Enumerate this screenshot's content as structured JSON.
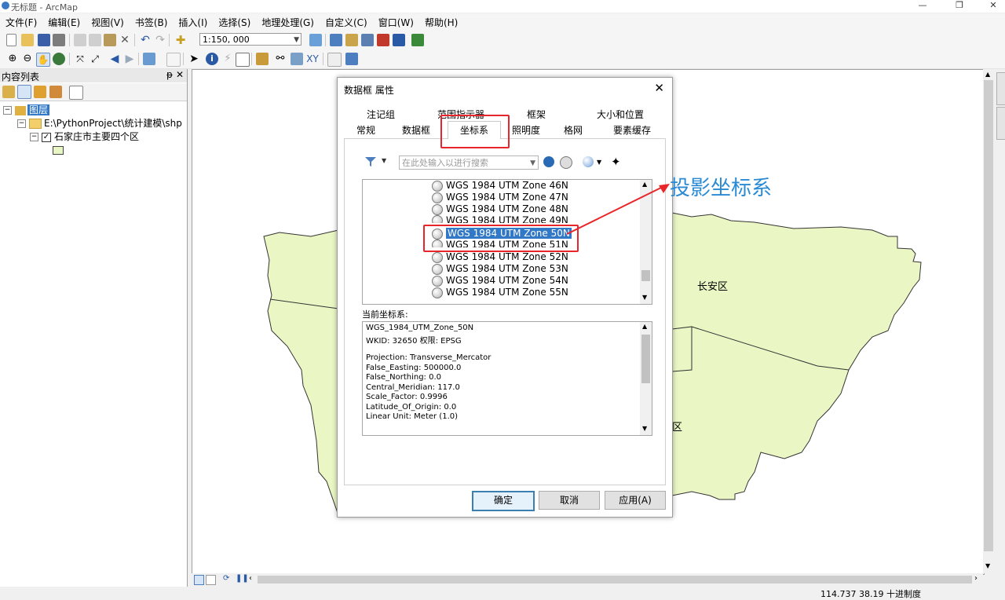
{
  "window": {
    "title": "无标题 - ArcMap",
    "min": "—",
    "max": "❐",
    "close": "✕"
  },
  "menu": [
    "文件(F)",
    "编辑(E)",
    "视图(V)",
    "书签(B)",
    "插入(I)",
    "选择(S)",
    "地理处理(G)",
    "自定义(C)",
    "窗口(W)",
    "帮助(H)"
  ],
  "toolbar": {
    "scale": "1:150, 000"
  },
  "toc": {
    "title": "内容列表",
    "pin": "ᵽ",
    "close": "✕",
    "layers_label": "图层",
    "folder": "E:\\PythonProject\\统计建模\\shp",
    "layer": "石家庄市主要四个区",
    "fill_color": "#e8f5c4"
  },
  "map": {
    "fill_color": "#eaf7c5",
    "labels": {
      "changan": "长安区",
      "partial": "区"
    }
  },
  "dialog": {
    "title": "数据框 属性",
    "close": "✕",
    "tabs_row1": [
      "注记组",
      "范围指示器",
      "框架",
      "大小和位置"
    ],
    "tabs_row2": [
      "常规",
      "数据框",
      "坐标系",
      "照明度",
      "格网",
      "要素缓存"
    ],
    "active_tab": "坐标系",
    "search_placeholder": "在此处输入以进行搜索",
    "crs_list": [
      "WGS 1984 UTM Zone 46N",
      "WGS 1984 UTM Zone 47N",
      "WGS 1984 UTM Zone 48N",
      "WGS 1984 UTM Zone 49N",
      "WGS 1984 UTM Zone 50N",
      "WGS 1984 UTM Zone 51N",
      "WGS 1984 UTM Zone 52N",
      "WGS 1984 UTM Zone 53N",
      "WGS 1984 UTM Zone 54N",
      "WGS 1984 UTM Zone 55N"
    ],
    "selected_crs": "WGS 1984 UTM Zone 50N",
    "current_label": "当前坐标系:",
    "current_details": [
      "WGS_1984_UTM_Zone_50N",
      "WKID: 32650 权限: EPSG",
      "",
      "Projection: Transverse_Mercator",
      "False_Easting: 500000.0",
      "False_Northing: 0.0",
      "Central_Meridian: 117.0",
      "Scale_Factor: 0.9996",
      "Latitude_Of_Origin: 0.0",
      "Linear Unit: Meter (1.0)"
    ],
    "buttons": {
      "ok": "确定",
      "cancel": "取消",
      "apply": "应用(A)"
    }
  },
  "annotation": {
    "text": "投影坐标系",
    "color": "#e8252b"
  },
  "status": {
    "coords": "114.737  38.19 十进制度"
  }
}
